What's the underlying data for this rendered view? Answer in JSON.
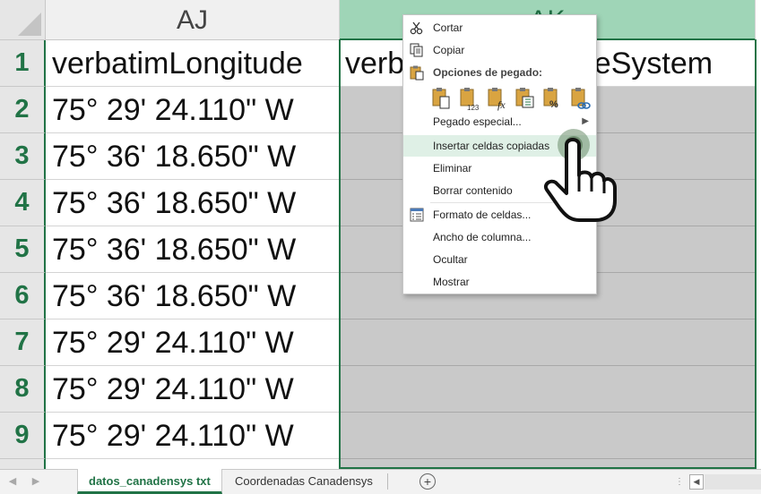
{
  "columns": {
    "aj": "AJ",
    "ak": "AK"
  },
  "rows": [
    {
      "num": "1",
      "aj": "verbatimLongitude",
      "ak": "verbatimCoordinateSystem"
    },
    {
      "num": "2",
      "aj": "75° 29' 24.110\" W",
      "ak": ""
    },
    {
      "num": "3",
      "aj": "75° 36' 18.650\" W",
      "ak": ""
    },
    {
      "num": "4",
      "aj": "75° 36' 18.650\" W",
      "ak": ""
    },
    {
      "num": "5",
      "aj": "75° 36' 18.650\" W",
      "ak": ""
    },
    {
      "num": "6",
      "aj": "75° 36' 18.650\" W",
      "ak": ""
    },
    {
      "num": "7",
      "aj": "75° 29' 24.110\" W",
      "ak": ""
    },
    {
      "num": "8",
      "aj": "75° 29' 24.110\" W",
      "ak": ""
    },
    {
      "num": "9",
      "aj": "75° 29' 24.110\" W",
      "ak": ""
    }
  ],
  "context_menu": {
    "cut": "Cortar",
    "copy": "Copiar",
    "paste_options_header": "Opciones de pegado:",
    "paste_icons": [
      "paste-icon",
      "paste-values-icon",
      "paste-formulas-icon",
      "paste-transpose-icon",
      "paste-formatting-icon",
      "paste-link-icon"
    ],
    "paste_special": "Pegado especial...",
    "insert_copied": "Insertar celdas copiadas",
    "delete": "Eliminar",
    "clear_contents": "Borrar contenido",
    "format_cells": "Formato de celdas...",
    "column_width": "Ancho de columna...",
    "hide": "Ocultar",
    "show": "Mostrar"
  },
  "sheet_tabs": {
    "active": "datos_canadensys txt",
    "other": "Coordenadas Canadensys"
  },
  "colors": {
    "accent": "#217346",
    "selected_header": "#9fd5b7",
    "selected_range": "#c9c9c9",
    "hover": "#dff0e6"
  }
}
